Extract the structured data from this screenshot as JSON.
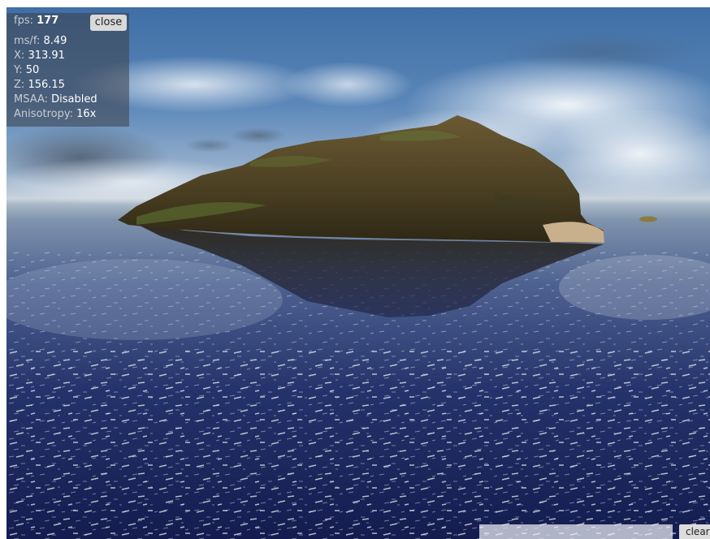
{
  "stats": {
    "fps_label": "fps:",
    "fps_value": "177",
    "close_label": "close",
    "mspf_label": "ms/f:",
    "mspf_value": "8.49",
    "x_label": "X:",
    "x_value": "313.91",
    "y_label": "Y:",
    "y_value": "50",
    "z_label": "Z:",
    "z_value": "156.15",
    "msaa_label": "MSAA:",
    "msaa_value": "Disabled",
    "aniso_label": "Anisotropy:",
    "aniso_value": "16x"
  },
  "console": {
    "input_value": "",
    "clear_label": "clear"
  },
  "colors": {
    "sky_top": "#3f6fa6",
    "horizon": "#c9d3dd",
    "ocean_deep": "#141c4f",
    "island": "#4a3f22",
    "grass": "#4f6a2c",
    "sand": "#c9b08c"
  }
}
